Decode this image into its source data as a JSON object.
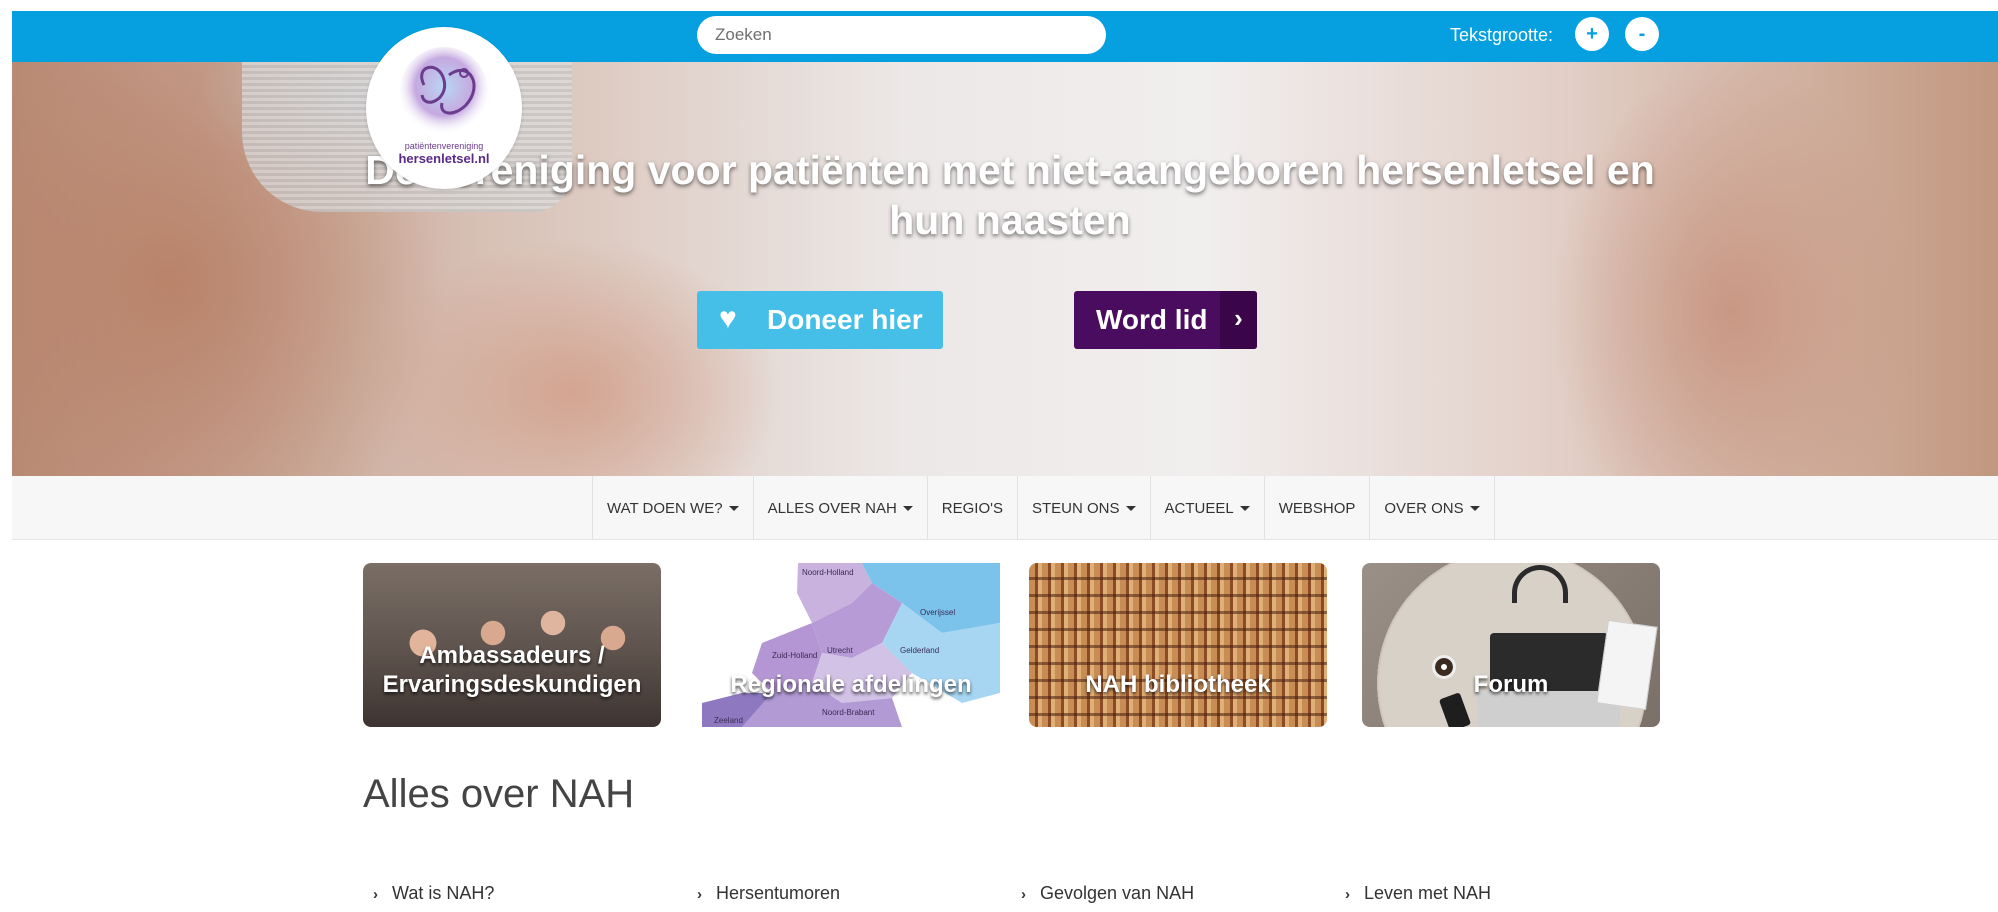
{
  "header": {
    "search_placeholder": "Zoeken",
    "text_size_label": "Tekstgrootte:",
    "increase_label": "+",
    "decrease_label": "-"
  },
  "logo": {
    "line1": "patiëntenvereniging",
    "line2": "hersenletsel.nl"
  },
  "hero": {
    "title": "Dé vereniging voor patiënten met niet-aangeboren hersenletsel en hun naasten",
    "donate_label": "Doneer hier",
    "join_label": "Word lid"
  },
  "nav": {
    "items": [
      {
        "label": "WAT DOEN WE?",
        "dropdown": true
      },
      {
        "label": "ALLES OVER NAH",
        "dropdown": true
      },
      {
        "label": "REGIO'S",
        "dropdown": false
      },
      {
        "label": "STEUN ONS",
        "dropdown": true
      },
      {
        "label": "ACTUEEL",
        "dropdown": true
      },
      {
        "label": "WEBSHOP",
        "dropdown": false
      },
      {
        "label": "OVER ONS",
        "dropdown": true
      }
    ]
  },
  "tiles": [
    {
      "caption": "Ambassadeurs / Ervaringsdeskundigen"
    },
    {
      "caption": "Regionale afdelingen",
      "map_labels": [
        "Noord-Holland",
        "Overijssel",
        "Gelderland",
        "Utrecht",
        "Zuid-Holland",
        "Noord-Brabant",
        "Zeeland"
      ]
    },
    {
      "caption": "NAH bibliotheek"
    },
    {
      "caption": "Forum"
    }
  ],
  "section": {
    "title": "Alles over NAH",
    "links": [
      "Wat is NAH?",
      "Hersentumoren",
      "Gevolgen van NAH",
      "Leven met NAH"
    ]
  },
  "colors": {
    "topbar": "#069fdf",
    "donate": "#45bfe8",
    "join": "#4a0c5e"
  }
}
